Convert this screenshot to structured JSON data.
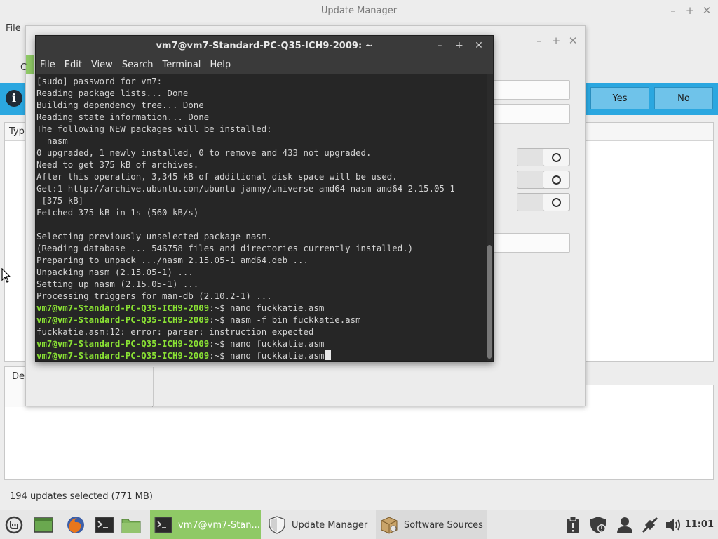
{
  "update_manager": {
    "title": "Update Manager",
    "menu_file": "File",
    "infobar": {
      "yes": "Yes",
      "no": "No"
    },
    "list_header_type": "Typ",
    "desc_tab": "Des",
    "status": "194 updates selected (771 MB)"
  },
  "dialog": {
    "partial_label": "C"
  },
  "terminal": {
    "title": "vm7@vm7-Standard-PC-Q35-ICH9-2009: ~",
    "menu": [
      "File",
      "Edit",
      "View",
      "Search",
      "Terminal",
      "Help"
    ],
    "prompt": "vm7@vm7-Standard-PC-Q35-ICH9-2009",
    "lines": [
      "[sudo] password for vm7:",
      "Reading package lists... Done",
      "Building dependency tree... Done",
      "Reading state information... Done",
      "The following NEW packages will be installed:",
      "  nasm",
      "0 upgraded, 1 newly installed, 0 to remove and 433 not upgraded.",
      "Need to get 375 kB of archives.",
      "After this operation, 3,345 kB of additional disk space will be used.",
      "Get:1 http://archive.ubuntu.com/ubuntu jammy/universe amd64 nasm amd64 2.15.05-1",
      " [375 kB]",
      "Fetched 375 kB in 1s (560 kB/s)",
      "",
      "Selecting previously unselected package nasm.",
      "(Reading database ... 546758 files and directories currently installed.)",
      "Preparing to unpack .../nasm_2.15.05-1_amd64.deb ...",
      "Unpacking nasm (2.15.05-1) ...",
      "Setting up nasm (2.15.05-1) ...",
      "Processing triggers for man-db (2.10.2-1) ..."
    ],
    "history": [
      {
        "path": ":~$",
        "cmd": " nano fuckkatie.asm"
      },
      {
        "path": ":~$",
        "cmd": " nasm -f bin fuckkatie.asm"
      },
      {
        "output": "fuckkatie.asm:12: error: parser: instruction expected"
      },
      {
        "path": ":~$",
        "cmd": " nano fuckkatie.asm"
      },
      {
        "path": ":~$",
        "cmd": " nano fuckkatie.asm",
        "current": true
      }
    ]
  },
  "taskbar": {
    "tasks": {
      "terminal": "vm7@vm7-Stan...",
      "update_manager": "Update Manager",
      "software_sources": "Software Sources"
    },
    "launchers": [
      "mint-menu-icon",
      "show-desktop-icon",
      "firefox-icon",
      "terminal-icon",
      "files-icon"
    ],
    "tray": [
      "clipboard-icon",
      "shield-icon",
      "user-icon",
      "network-icon",
      "volume-icon"
    ],
    "clock": "11:01"
  },
  "colors": {
    "infobar": "#2ba7e0",
    "prompt": "#8ae234",
    "active_task": "#8fc966"
  }
}
